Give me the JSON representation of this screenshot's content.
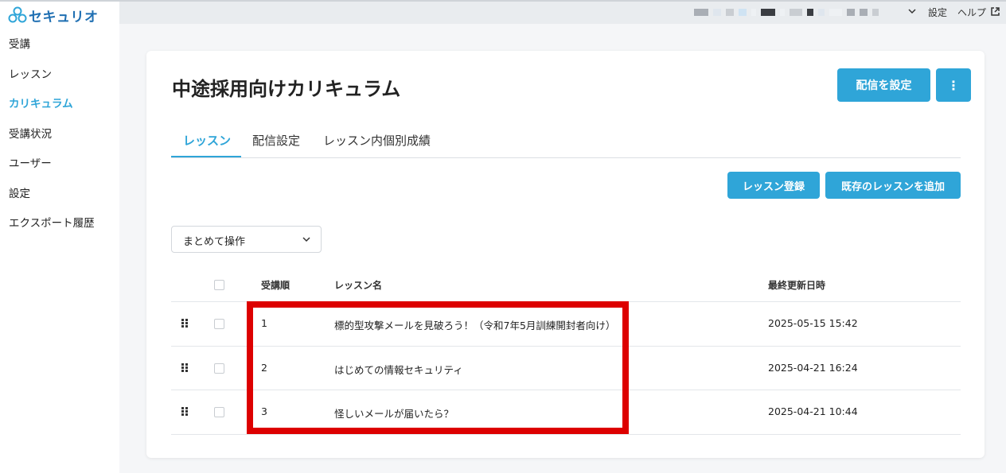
{
  "brand": {
    "name": "セキュリオ",
    "accent": "#2fa5d8",
    "highlight": "#dd0000"
  },
  "sidebar": {
    "items": [
      {
        "label": "受講"
      },
      {
        "label": "レッスン"
      },
      {
        "label": "カリキュラム",
        "active": true
      },
      {
        "label": "受講状況"
      },
      {
        "label": "ユーザー"
      },
      {
        "label": "設定"
      },
      {
        "label": "エクスポート履歴"
      }
    ]
  },
  "header": {
    "settings": "設定",
    "help": "ヘルプ",
    "help_icon": "external-link-icon",
    "account_chevron": "chevron-down-icon"
  },
  "page": {
    "title": "中途採用向けカリキュラム",
    "deliver_button": "配信を設定",
    "more_icon": "⋮",
    "tabs": [
      {
        "label": "レッスン",
        "active": true
      },
      {
        "label": "配信設定"
      },
      {
        "label": "レッスン内個別成績"
      }
    ],
    "register_button": "レッスン登録",
    "add_existing_button": "既存のレッスンを追加",
    "bulk_action": {
      "selected": "まとめて操作"
    }
  },
  "table": {
    "columns": {
      "order": "受講順",
      "name": "レッスン名",
      "updated": "最終更新日時"
    },
    "rows": [
      {
        "order": "1",
        "name": "標的型攻撃メールを見破ろう！（令和7年5月訓練開封者向け）",
        "updated": "2025-05-15 15:42"
      },
      {
        "order": "2",
        "name": "はじめての情報セキュリティ",
        "updated": "2025-04-21 16:24"
      },
      {
        "order": "3",
        "name": "怪しいメールが届いたら？",
        "updated": "2025-04-21 10:44"
      }
    ]
  }
}
